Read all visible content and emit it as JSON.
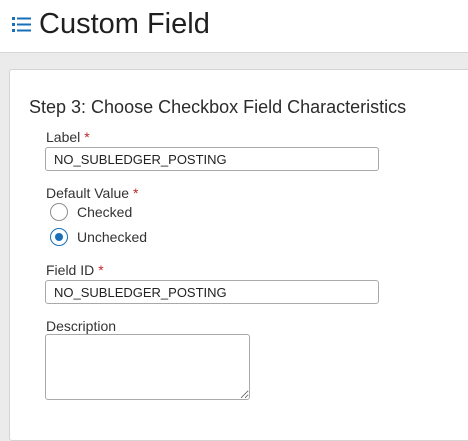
{
  "header": {
    "title": "Custom Field",
    "icon": "list-icon",
    "icon_color": "#1a6fb8"
  },
  "form": {
    "step_title": "Step 3: Choose Checkbox Field Characteristics",
    "required_marker": "*",
    "label": {
      "label": "Label",
      "value": "NO_SUBLEDGER_POSTING"
    },
    "default_value": {
      "label": "Default Value",
      "options": [
        {
          "label": "Checked",
          "selected": false
        },
        {
          "label": "Unchecked",
          "selected": true
        }
      ]
    },
    "field_id": {
      "label": "Field ID",
      "value": "NO_SUBLEDGER_POSTING"
    },
    "description": {
      "label": "Description",
      "value": ""
    }
  },
  "colors": {
    "accent": "#1a6fb8",
    "required": "#c0272d",
    "page_background": "#ebebeb"
  }
}
